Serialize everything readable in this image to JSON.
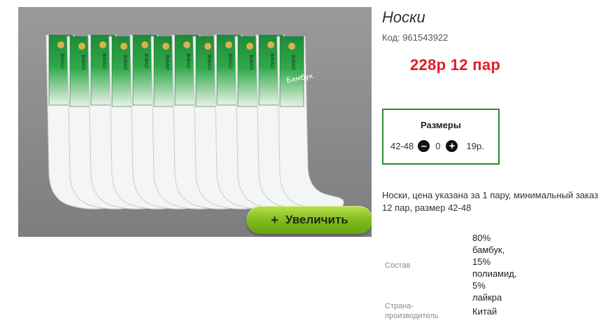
{
  "product": {
    "title": "Носки",
    "code": "Код: 961543922",
    "price": "228р  12 пар",
    "image_alt": "Мужские белые носки (бамбук), 12 пар",
    "zoom_label": "Увеличить",
    "zoom_icon": "+",
    "package_labels": {
      "brand": "BIBAO",
      "material": "Бамбук"
    }
  },
  "sizes": {
    "title": "Размеры",
    "rows": [
      {
        "size": "42-48",
        "quantity": "0",
        "price": "19р."
      }
    ],
    "minus_icon": "minus-circle-icon",
    "plus_icon": "plus-circle-icon"
  },
  "description": "Носки, цена указана за 1 пару, минимальный заказ 12 пар, размер 42-48",
  "specs": [
    {
      "label": "Состав",
      "value_lines": [
        "80%",
        "бамбук,",
        "15%",
        "полиамид,",
        "5%",
        "лайкра"
      ]
    },
    {
      "label_lines": [
        "Страна-",
        "производитель"
      ],
      "value": "Китай"
    }
  ],
  "colors": {
    "price": "#e31e24",
    "sizes_border": "#2e8b2e",
    "button_green": "#7cb81d",
    "photo_bg": "#8e8e90"
  }
}
